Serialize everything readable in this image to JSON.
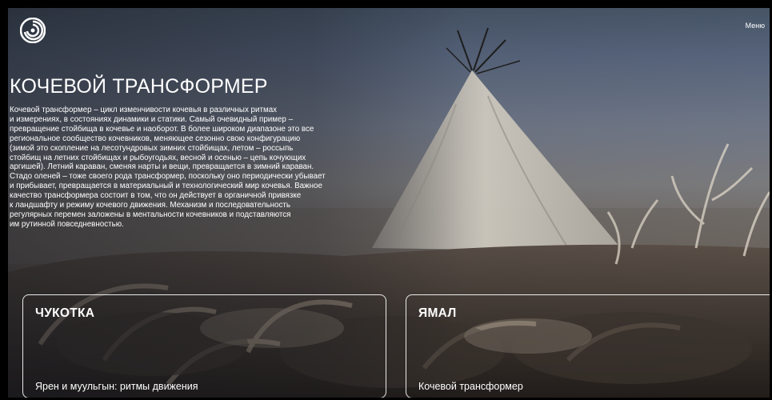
{
  "header": {
    "logo_icon": "spiral-logo-icon",
    "menu_label": "Меню"
  },
  "hero": {
    "title": "КОЧЕВОЙ ТРАНСФОРМЕР",
    "description": "Кочевой трансформер – цикл изменчивости кочевья в различных ритмах\nи измерениях, в состояниях динамики и статики. Самый очевидный пример –\nпревращение стойбища в кочевье и наоборот. В более широком диапазоне это все\nрегиональное сообщество кочевников, меняющее сезонно свою конфигурацию\n(зимой это скопление на лесотундровых зимних стойбищах, летом – россыпь\nстойбищ на летних стойбищах и рыбоугодьях, весной и осенью – цепь кочующих\nаргишей). Летний караван, сменяя нарты и вещи, превращается в зимний караван.\nСтадо оленей – тоже своего рода трансформер, поскольку оно периодически убывает\nи прибывает, превращается в материальный и технологический мир кочевья. Важное\nкачество трансформера состоит в том, что он действует в органичной привязке\nк ландшафту и режиму кочевого движения. Механизм и последовательность\nрегулярных перемен заложены в ментальности кочевников и подставляются\nим рутинной повседневностью."
  },
  "cards": [
    {
      "region": "ЧУКОТКА",
      "subtitle": "Ярен и муульгын: ритмы движения"
    },
    {
      "region": "ЯМАЛ",
      "subtitle": "Кочевой трансформер"
    }
  ],
  "colors": {
    "text": "#ffffff",
    "sky": "#56637a",
    "tent": "#cfcabf",
    "ground": "#2a2522"
  }
}
